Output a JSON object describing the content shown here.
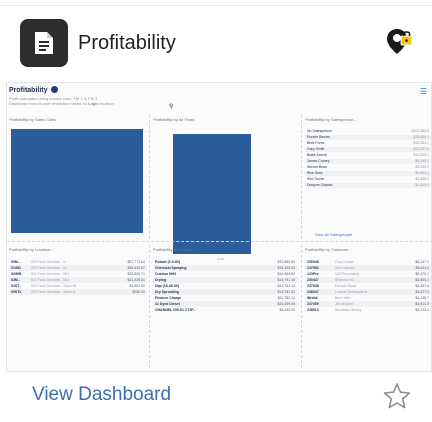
{
  "header": {
    "title": "Profitability",
    "icon": "dashboard-icon",
    "action_icon": "geo-lock-icon"
  },
  "preview": {
    "title": "Profitability",
    "subtitle_line1": "Profit calculated using invoice cost / FM 1 to FM 3",
    "subtitle_line2": "Dashboard honors user restriction based on",
    "subtitle_bold": "Login",
    "subtitle_tail": "location",
    "pane_sales_class": "Profitability by Sales Class",
    "pane_all_years": "Profitability by All Years",
    "pane_salesperson": "Profitability by Salesperson...",
    "pane_location": "Profitability by Location...",
    "pane_product": "Profitability by Product...",
    "pane_customer": "Profitability by Customer...",
    "year_label": "2018",
    "view_all": "View All Salespeople",
    "salespeople": [
      {
        "name": "No Salesperson",
        "value": "$202,982.5"
      },
      {
        "name": "Ronnie Barnes",
        "value": "$28,086.1"
      },
      {
        "name": "Brett Fores",
        "value": "$16,283.1"
      },
      {
        "name": "Gary Smith",
        "value": "$12,037.2"
      },
      {
        "name": "Blake Arnold",
        "value": "$10,523.1"
      },
      {
        "name": "James Craney",
        "value": "$9,195.1"
      },
      {
        "name": "Steven Bean",
        "value": "$3,039.0"
      },
      {
        "name": "Rick Sims",
        "value": "$2,654.1"
      },
      {
        "name": "Red Turner",
        "value": "$2,590.0"
      },
      {
        "name": "Dwayne Clayton",
        "value": "$1,303.1"
      }
    ],
    "locations": [
      {
        "code": "00M..",
        "desc": "SSI Farm Services - IL",
        "value": "$57,773.64"
      },
      {
        "code": "01/ND",
        "desc": "SSI Farm Services - IN",
        "value": "$45,443.57"
      },
      {
        "code": "02/MN",
        "desc": "SSI Farm Services - MN",
        "value": "$33,500.71"
      },
      {
        "code": "02M..",
        "desc": "SSI Farm Services - MO",
        "value": "$21,428.61"
      },
      {
        "code": "04ST..",
        "desc": "SSI Farm Services - Store IN",
        "value": "$1,961.92"
      },
      {
        "code": "05STk",
        "desc": "SSI Farm Services - Store IL",
        "value": "$250.00"
      }
    ],
    "products": [
      {
        "name": "Potash (0-0-60)",
        "value": "$33,863.50"
      },
      {
        "name": "Chemical Spraying",
        "value": "$16,303.03"
      },
      {
        "name": "Custom NH3",
        "value": "$14,964.64"
      },
      {
        "name": "Drying",
        "value": "$14,791.18"
      },
      {
        "name": "Dap (18-46-00)",
        "value": "$14,761.12"
      },
      {
        "name": "Dry Spreading",
        "value": "$13,781.92"
      },
      {
        "name": "Finance Charge",
        "value": "$11,782.14"
      },
      {
        "name": "#1 Dyed Diesel",
        "value": "$10,259.08"
      },
      {
        "name": "CHANNEL 209-51 VT2P...",
        "value": "$9,432.00"
      }
    ],
    "customers": [
      {
        "code": "230346",
        "name": "Gary Knake",
        "value": "$6,147.1"
      },
      {
        "code": "237952",
        "name": "Scot Hauser",
        "value": "$5,611.4"
      },
      {
        "code": "123Pro",
        "name": "123 Processing",
        "value": "$5,479.1"
      },
      {
        "code": "230447",
        "name": "Shawna Fal",
        "value": "$4,550.1"
      },
      {
        "code": "237636",
        "name": "Darryel Studs",
        "value": "$4,457.4"
      },
      {
        "code": "236047",
        "name": "Loome Christophene",
        "value": "$4,227.2"
      },
      {
        "code": "Wreba",
        "name": "Barb Wire",
        "value": "$4,136.7"
      },
      {
        "code": "237359",
        "name": "Jim Musher",
        "value": "$3,914.0"
      },
      {
        "code": "238010",
        "name": "Armando Hersey",
        "value": "$3,723.1"
      }
    ]
  },
  "footer": {
    "view_dashboard": "View Dashboard",
    "favorite_icon": "star-outline-icon"
  },
  "colors": {
    "accent": "#3c6fb0",
    "bar": "#2b5d9c",
    "icon_bg": "#2d2d2f"
  }
}
